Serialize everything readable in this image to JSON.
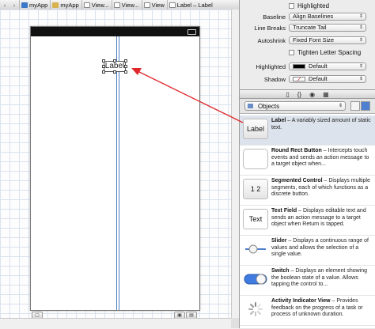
{
  "breadcrumb": {
    "items": [
      {
        "label": "myApp",
        "icon": "project-icon"
      },
      {
        "label": "myApp",
        "icon": "folder-icon"
      },
      {
        "label": "View...",
        "icon": "file-icon"
      },
      {
        "label": "View...",
        "icon": "file-icon"
      },
      {
        "label": "View",
        "icon": "file-icon"
      },
      {
        "label": "Label – Label",
        "icon": "file-icon"
      }
    ]
  },
  "canvas": {
    "label_text": "Label"
  },
  "inspector": {
    "highlighted_check_label": "Highlighted",
    "baseline": {
      "label": "Baseline",
      "value": "Align Baselines"
    },
    "line_breaks": {
      "label": "Line Breaks",
      "value": "Truncate Tail"
    },
    "autoshrink": {
      "label": "Autoshrink",
      "value": "Fixed Font Size"
    },
    "tighten_label": "Tighten Letter Spacing",
    "highlighted_color": {
      "label": "Highlighted",
      "value": "Default"
    },
    "shadow_color": {
      "label": "Shadow",
      "value": "Default"
    }
  },
  "library": {
    "selected": "Objects",
    "items": [
      {
        "thumb": "Label",
        "name": "Label",
        "desc": " – A variably sized amount of static text."
      },
      {
        "thumb": "",
        "name": "Round Rect Button",
        "desc": " – Intercepts touch events and sends an action message to a target object when..."
      },
      {
        "thumb": "1 2",
        "name": "Segmented Control",
        "desc": " – Displays multiple segments, each of which functions as a discrete button."
      },
      {
        "thumb": "Text",
        "name": "Text Field",
        "desc": " – Displays editable text and sends an action message to a target object when Return is tapped."
      },
      {
        "thumb": "",
        "name": "Slider",
        "desc": " – Displays a continuous range of values and allows the selection of a single value."
      },
      {
        "thumb": "",
        "name": "Switch",
        "desc": " – Displays an element showing the boolean state of a value. Allows tapping the control to..."
      },
      {
        "thumb": "",
        "name": "Activity Indicator View",
        "desc": " – Provides feedback on the progress of a task or process of unknown duration."
      }
    ]
  },
  "colors": {
    "arrow": "#e0282c",
    "selection": "#dde3ec",
    "switch_on": "#3f7be0"
  }
}
